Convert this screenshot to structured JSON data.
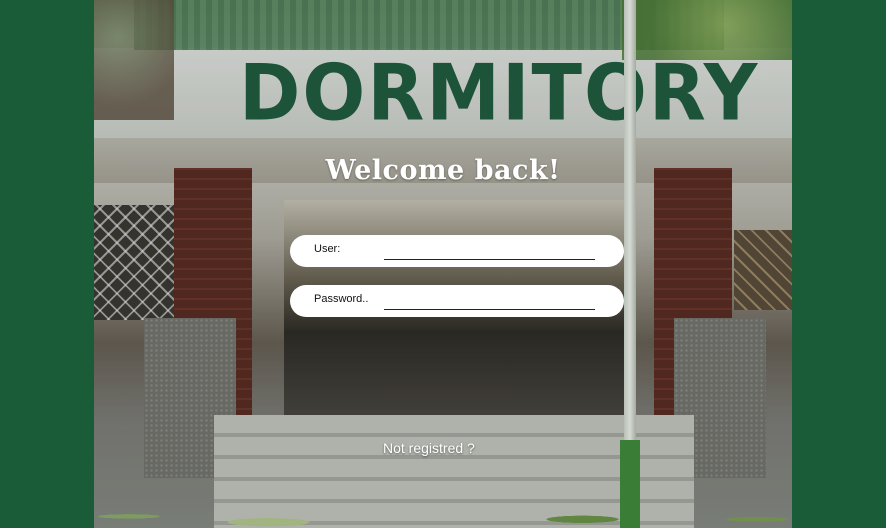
{
  "background": {
    "frame_color": "#1a5c38",
    "sign_text": "DORMITORY",
    "sign_color": "#1f5a3d"
  },
  "login": {
    "title": "Welcome back!",
    "user_label": "User:",
    "user_value": "",
    "password_label": "Password..",
    "password_value": "",
    "register_link": "Not registred ?"
  }
}
